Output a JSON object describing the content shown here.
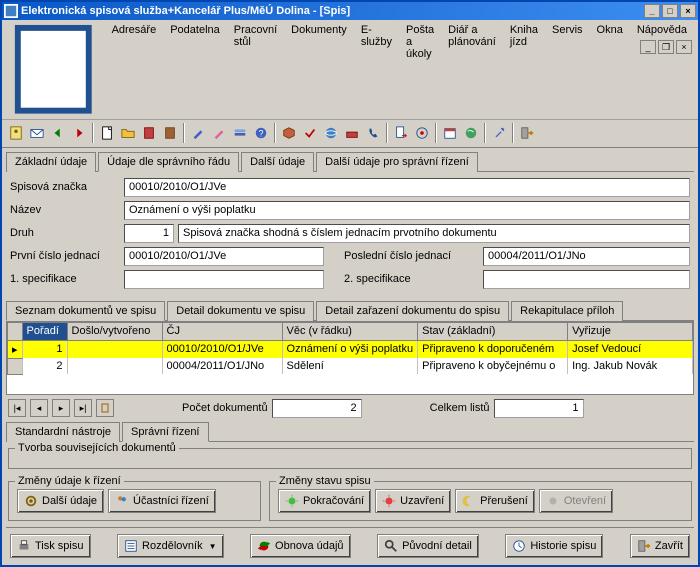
{
  "window_title": "Elektronická spisová služba+Kancelář Plus/MěÚ Dolina - [Spis]",
  "menu": [
    "Adresáře",
    "Podatelna",
    "Pracovní stůl",
    "Dokumenty",
    "E-služby",
    "Pošta a úkoly",
    "Diář a plánování",
    "Kniha jízd",
    "Servis",
    "Okna",
    "Nápověda"
  ],
  "tabs_main": {
    "items": [
      "Základní údaje",
      "Údaje dle správního řádu",
      "Další údaje",
      "Další údaje pro správní řízení"
    ],
    "active": 1
  },
  "form": {
    "spisova_znacka_label": "Spisová značka",
    "spisova_znacka": "00010/2010/O1/JVe",
    "nazev_label": "Název",
    "nazev": "Oznámení o výši poplatku",
    "druh_label": "Druh",
    "druh_code": "1",
    "druh_text": "Spisová značka shodná s číslem jednacím prvotního dokumentu",
    "prvni_label": "První číslo jednací",
    "prvni": "00010/2010/O1/JVe",
    "posledni_label": "Poslední číslo jednací",
    "posledni": "00004/2011/O1/JNo",
    "spec1_label": "1. specifikace",
    "spec1": "",
    "spec2_label": "2. specifikace",
    "spec2": ""
  },
  "grid_tabs": {
    "items": [
      "Seznam dokumentů ve spisu",
      "Detail dokumentu ve spisu",
      "Detail zařazení dokumentu do spisu",
      "Rekapitulace příloh"
    ],
    "active": 0
  },
  "grid": {
    "columns": [
      "Pořadí",
      "Došlo/vytvořeno",
      "ČJ",
      "Věc (v řádku)",
      "Stav (základní)",
      "Vyřizuje"
    ],
    "rows": [
      {
        "poradi": "1",
        "doslo": "",
        "cj": "00010/2010/O1/JVe",
        "vec": "Oznámení o výši poplatku",
        "stav": "Připraveno k doporučeném",
        "vyrizuje": "Josef Vedoucí",
        "sel": true
      },
      {
        "poradi": "2",
        "doslo": "",
        "cj": "00004/2011/O1/JNo",
        "vec": "Sdělení",
        "stav": "Připraveno k obyčejnému o",
        "vyrizuje": "Ing. Jakub Novák",
        "sel": false
      }
    ]
  },
  "summary": {
    "pocet_label": "Počet dokumentů",
    "pocet": "2",
    "listu_label": "Celkem listů",
    "listu": "1"
  },
  "bottom_tabs": {
    "items": [
      "Standardní nástroje",
      "Správní řízení"
    ],
    "active": 1
  },
  "tvorba_legend": "Tvorba souvisejících dokumentů",
  "zmeny_rizeni_legend": "Změny údaje k řízení",
  "zmeny_stavu_legend": "Změny stavu spisu",
  "buttons": {
    "dalsi_udaje": "Další údaje",
    "ucastnici": "Účastníci řízení",
    "pokracovani": "Pokračování",
    "uzavreni": "Uzavření",
    "preruseni": "Přerušení",
    "otevreni": "Otevření",
    "tisk": "Tisk spisu",
    "rozdelovnik": "Rozdělovník",
    "obnova": "Obnova údajů",
    "puvodni": "Původní detail",
    "historie": "Historie spisu",
    "zavrit": "Zavřít"
  }
}
